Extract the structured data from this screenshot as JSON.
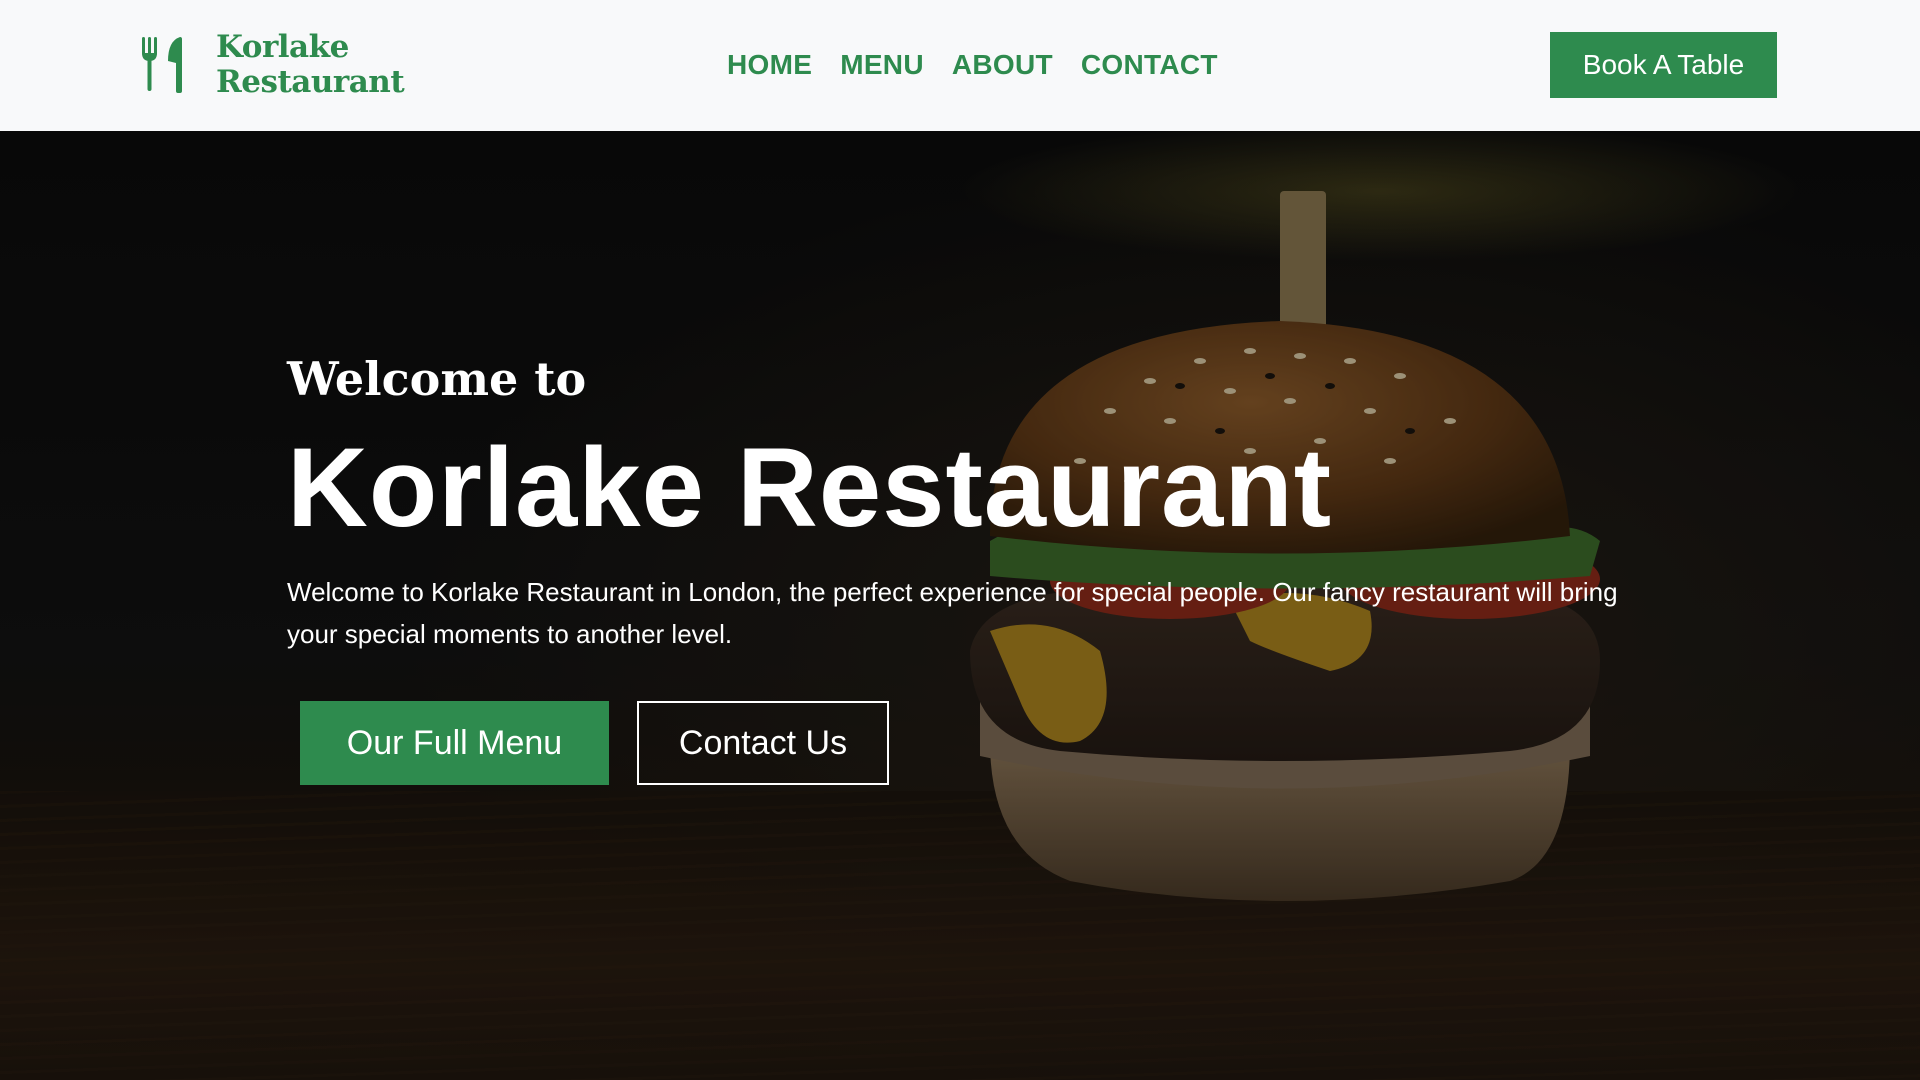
{
  "brand": {
    "name_line1": "Korlake",
    "name_line2": "Restaurant",
    "icon": "fork-spoon-icon",
    "color": "#2e8b4e"
  },
  "nav": {
    "items": [
      {
        "label": "HOME"
      },
      {
        "label": "MENU"
      },
      {
        "label": "ABOUT"
      },
      {
        "label": "CONTACT"
      }
    ]
  },
  "header": {
    "cta_label": "Book A Table"
  },
  "hero": {
    "pre_title": "Welcome to",
    "title": "Korlake Restaurant",
    "description": "Welcome to Korlake Restaurant in London, the perfect experience for special people. Our fancy restaurant will bring your special moments to another level.",
    "primary_button": "Our Full Menu",
    "secondary_button": "Contact Us",
    "background_image": "burger-photo"
  },
  "colors": {
    "accent": "#2e8b4e",
    "header_bg": "#f8f9fa",
    "hero_text": "#ffffff"
  }
}
